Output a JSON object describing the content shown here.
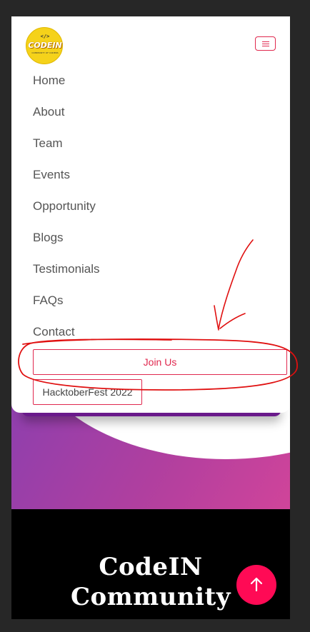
{
  "logo": {
    "code_glyph": "</>",
    "brand": "CODEIN",
    "tagline": "COMMUNITY OF CODERS"
  },
  "nav": {
    "items": [
      "Home",
      "About",
      "Team",
      "Events",
      "Opportunity",
      "Blogs",
      "Testimonials",
      "FAQs",
      "Contact"
    ],
    "join_label": "Join Us",
    "hacktober_label": "HacktoberFest 2022"
  },
  "hero": {
    "title_line1": "CodeIN",
    "title_line2": "Community"
  },
  "colors": {
    "accent": "#e0284e",
    "scroll_top": "#ff0a55",
    "hero_gradient_start": "#8d3fae",
    "hero_gradient_end": "#d0449a",
    "annotation": "#e01010"
  },
  "icons": {
    "toggler": "hamburger-menu-icon",
    "scroll_top": "arrow-up-icon"
  }
}
